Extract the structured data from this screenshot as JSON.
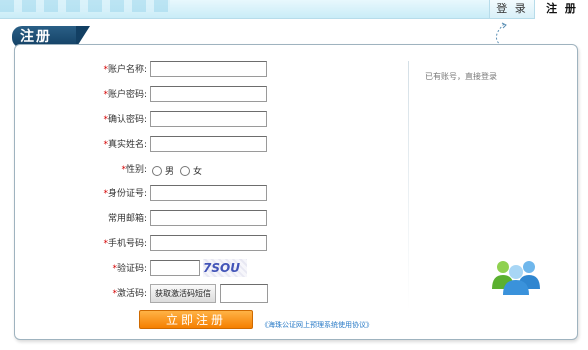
{
  "header": {
    "tabs": [
      {
        "label": "登 录"
      },
      {
        "label": "注 册"
      }
    ]
  },
  "panel": {
    "title": "注册",
    "side_link": "已有账号，直接登录",
    "agreement_link": "《海珠公证网上预理系统使用协议》",
    "submit_label": "立即注册"
  },
  "form": {
    "required_mark": "*",
    "fields": [
      {
        "label": "账户名称:",
        "required": true,
        "value": ""
      },
      {
        "label": "账户密码:",
        "required": true,
        "value": ""
      },
      {
        "label": "确认密码:",
        "required": true,
        "value": ""
      },
      {
        "label": "真实姓名:",
        "required": true,
        "value": ""
      },
      {
        "label": "性别:",
        "required": true,
        "options": [
          "男",
          "女"
        ]
      },
      {
        "label": "身份证号:",
        "required": true,
        "value": ""
      },
      {
        "label": "常用邮箱:",
        "required": false,
        "value": ""
      },
      {
        "label": "手机号码:",
        "required": true,
        "value": ""
      },
      {
        "label": "验证码:",
        "required": true,
        "value": "",
        "captcha_text": "7SOU"
      },
      {
        "label": "激活码:",
        "required": true,
        "value": "",
        "button_label": "获取激活码短信"
      }
    ]
  },
  "colors": {
    "accent_orange": "#f57f00",
    "title_blue": "#123f63",
    "required_red": "#d40000",
    "link_blue": "#2a7bc7"
  },
  "icons": [
    "users-icon",
    "dashed-arrow-icon"
  ]
}
